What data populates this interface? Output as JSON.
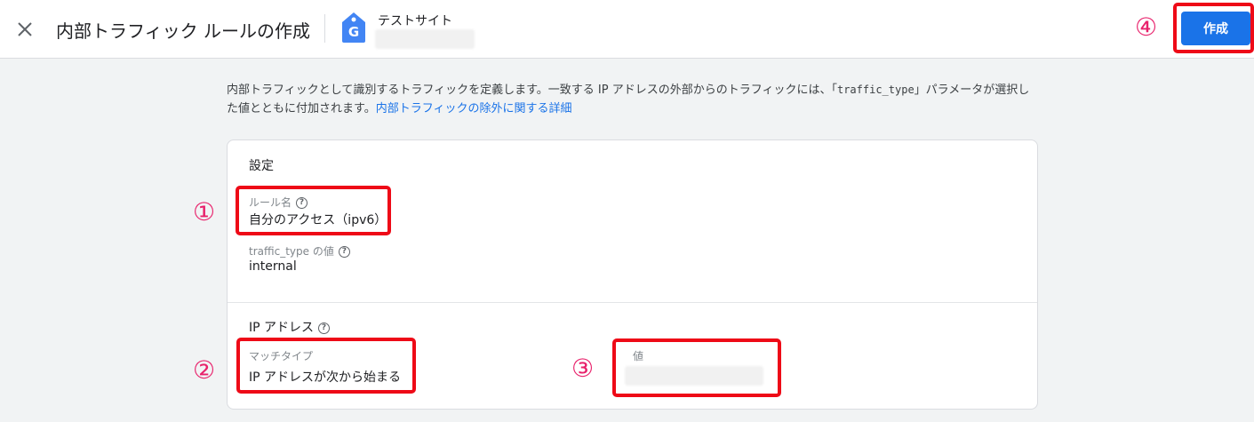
{
  "header": {
    "close_icon": "close-icon",
    "title": "内部トラフィック ルールの作成",
    "property_icon": "google-analytics-tag-icon",
    "logo_letter": "G",
    "site_name": "テストサイト",
    "create_label": "作成"
  },
  "description": {
    "text_part1": "内部トラフィックとして識別するトラフィックを定義します。一致する IP アドレスの外部からのトラフィックには、「",
    "code": "traffic_type",
    "text_part2": "」パラメータが選択した値とともに付加されます。",
    "link": "内部トラフィックの除外に関する詳細"
  },
  "settings": {
    "section_title": "設定",
    "rule_name": {
      "label": "ルール名",
      "value": "自分のアクセス（ipv6）"
    },
    "traffic_type": {
      "label": "traffic_type の値",
      "value": "internal"
    },
    "help_icon": "help-circle-icon"
  },
  "ip_address": {
    "section_title": "IP アドレス",
    "match_type": {
      "label": "マッチタイプ",
      "value": "IP アドレスが次から始まる"
    },
    "value": {
      "label": "値"
    }
  },
  "annotations": {
    "marker1": "①",
    "marker2": "②",
    "marker3": "③",
    "marker4": "④",
    "box_color": "#ee0a17",
    "marker_color": "#e8216b"
  },
  "colors": {
    "primary": "#1a73e8",
    "background": "#f1f3f4"
  }
}
